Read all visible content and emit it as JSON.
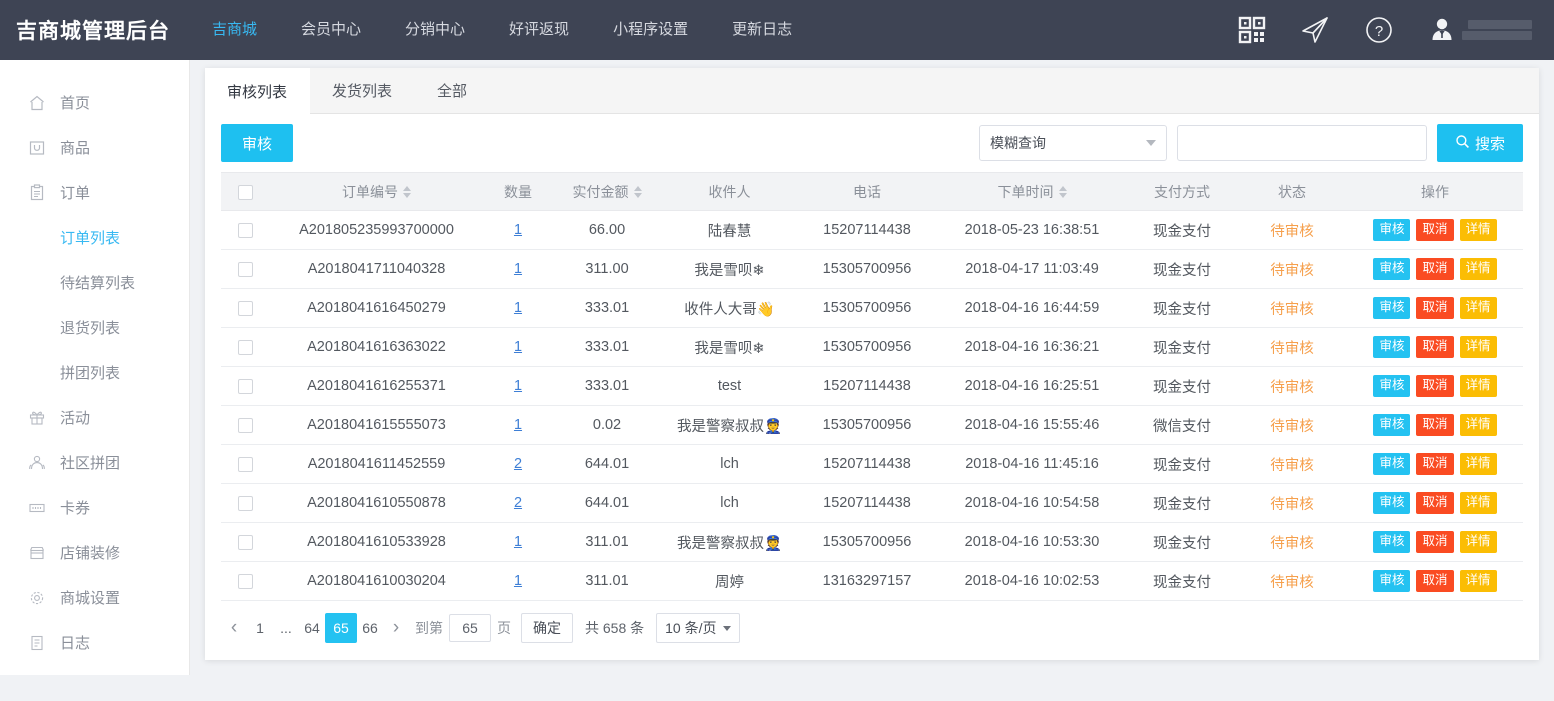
{
  "header": {
    "brand": "吉商城管理后台",
    "nav": [
      {
        "label": "吉商城",
        "active": true
      },
      {
        "label": "会员中心",
        "active": false
      },
      {
        "label": "分销中心",
        "active": false
      },
      {
        "label": "好评返现",
        "active": false
      },
      {
        "label": "小程序设置",
        "active": false
      },
      {
        "label": "更新日志",
        "active": false
      }
    ],
    "icons": [
      "qrcode-icon",
      "send-icon",
      "help-icon",
      "avatar-icon"
    ],
    "username_redacted": true,
    "bg_color": "#3e4454",
    "accent_color": "#38b9f2"
  },
  "sidebar": {
    "items": [
      {
        "label": "首页",
        "icon": "home-icon",
        "type": "parent"
      },
      {
        "label": "商品",
        "icon": "goods-icon",
        "type": "parent"
      },
      {
        "label": "订单",
        "icon": "order-icon",
        "type": "parent"
      },
      {
        "label": "订单列表",
        "icon": "",
        "type": "child",
        "active": true
      },
      {
        "label": "待结算列表",
        "icon": "",
        "type": "child",
        "active": false
      },
      {
        "label": "退货列表",
        "icon": "",
        "type": "child",
        "active": false
      },
      {
        "label": "拼团列表",
        "icon": "",
        "type": "child",
        "active": false
      },
      {
        "label": "活动",
        "icon": "gift-icon",
        "type": "parent"
      },
      {
        "label": "社区拼团",
        "icon": "community-icon",
        "type": "parent"
      },
      {
        "label": "卡券",
        "icon": "ticket-icon",
        "type": "parent"
      },
      {
        "label": "店铺装修",
        "icon": "shop-icon",
        "type": "parent"
      },
      {
        "label": "商城设置",
        "icon": "gear-icon",
        "type": "parent"
      },
      {
        "label": "日志",
        "icon": "log-icon",
        "type": "parent"
      }
    ]
  },
  "main": {
    "tabs": [
      {
        "label": "审核列表",
        "active": true
      },
      {
        "label": "发货列表",
        "active": false
      },
      {
        "label": "全部",
        "active": false
      }
    ],
    "toolbar": {
      "audit_button": "审核",
      "filter_selected": "模糊查询",
      "search_value": "",
      "search_placeholder": "",
      "search_button": "搜索",
      "search_icon": "search-icon"
    },
    "table": {
      "columns": [
        {
          "label": "",
          "sortable": false,
          "key": "checkbox"
        },
        {
          "label": "订单编号",
          "sortable": true,
          "key": "order_no"
        },
        {
          "label": "数量",
          "sortable": false,
          "key": "qty"
        },
        {
          "label": "实付金额",
          "sortable": true,
          "key": "amount"
        },
        {
          "label": "收件人",
          "sortable": false,
          "key": "receiver"
        },
        {
          "label": "电话",
          "sortable": false,
          "key": "phone"
        },
        {
          "label": "下单时间",
          "sortable": true,
          "key": "time"
        },
        {
          "label": "支付方式",
          "sortable": false,
          "key": "pay"
        },
        {
          "label": "状态",
          "sortable": false,
          "key": "status"
        },
        {
          "label": "操作",
          "sortable": false,
          "key": "actions"
        }
      ],
      "rows": [
        {
          "order_no": "A201805235993700000",
          "qty": "1",
          "amount": "66.00",
          "receiver": "陆春慧",
          "phone": "15207114438",
          "time": "2018-05-23 16:38:51",
          "pay": "现金支付",
          "status": "待审核"
        },
        {
          "order_no": "A2018041711040328",
          "qty": "1",
          "amount": "311.00",
          "receiver": "我是雪呗❄",
          "phone": "15305700956",
          "time": "2018-04-17 11:03:49",
          "pay": "现金支付",
          "status": "待审核"
        },
        {
          "order_no": "A2018041616450279",
          "qty": "1",
          "amount": "333.01",
          "receiver": "收件人大哥👋",
          "phone": "15305700956",
          "time": "2018-04-16 16:44:59",
          "pay": "现金支付",
          "status": "待审核"
        },
        {
          "order_no": "A2018041616363022",
          "qty": "1",
          "amount": "333.01",
          "receiver": "我是雪呗❄",
          "phone": "15305700956",
          "time": "2018-04-16 16:36:21",
          "pay": "现金支付",
          "status": "待审核"
        },
        {
          "order_no": "A2018041616255371",
          "qty": "1",
          "amount": "333.01",
          "receiver": "test",
          "phone": "15207114438",
          "time": "2018-04-16 16:25:51",
          "pay": "现金支付",
          "status": "待审核"
        },
        {
          "order_no": "A2018041615555073",
          "qty": "1",
          "amount": "0.02",
          "receiver": "我是警察叔叔👮",
          "phone": "15305700956",
          "time": "2018-04-16 15:55:46",
          "pay": "微信支付",
          "status": "待审核"
        },
        {
          "order_no": "A2018041611452559",
          "qty": "2",
          "amount": "644.01",
          "receiver": "lch",
          "phone": "15207114438",
          "time": "2018-04-16 11:45:16",
          "pay": "现金支付",
          "status": "待审核"
        },
        {
          "order_no": "A2018041610550878",
          "qty": "2",
          "amount": "644.01",
          "receiver": "lch",
          "phone": "15207114438",
          "time": "2018-04-16 10:54:58",
          "pay": "现金支付",
          "status": "待审核"
        },
        {
          "order_no": "A2018041610533928",
          "qty": "1",
          "amount": "311.01",
          "receiver": "我是警察叔叔👮",
          "phone": "15305700956",
          "time": "2018-04-16 10:53:30",
          "pay": "现金支付",
          "status": "待审核"
        },
        {
          "order_no": "A2018041610030204",
          "qty": "1",
          "amount": "311.01",
          "receiver": "周婷",
          "phone": "13163297157",
          "time": "2018-04-16 10:02:53",
          "pay": "现金支付",
          "status": "待审核"
        }
      ],
      "row_actions": [
        {
          "label": "审核",
          "color": "#24c2f1"
        },
        {
          "label": "取消",
          "color": "#fa4b22"
        },
        {
          "label": "详情",
          "color": "#fbbd04"
        }
      ]
    },
    "pagination": {
      "prev_icon": "chevron-left-icon",
      "next_icon": "chevron-right-icon",
      "pages": [
        "1",
        "...",
        "64",
        "65",
        "66"
      ],
      "current_page": "65",
      "jump_label": "到第",
      "jump_value": "65",
      "page_unit": "页",
      "confirm_label": "确定",
      "total_text": "共 658 条",
      "page_size": "10 条/页"
    }
  }
}
